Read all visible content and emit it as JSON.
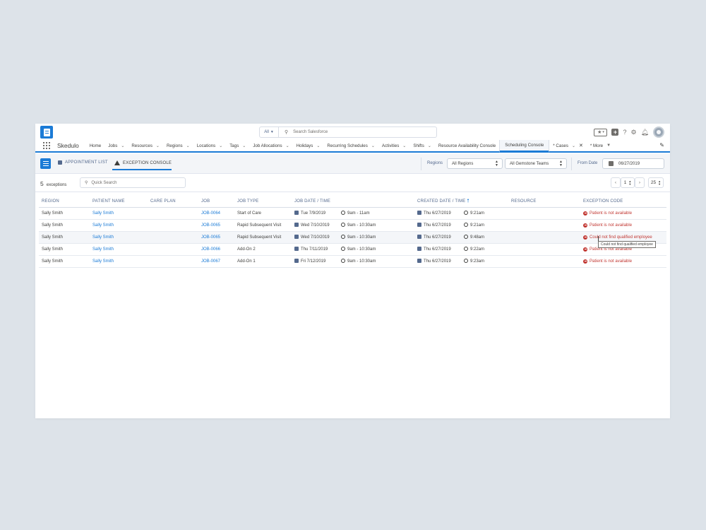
{
  "header": {
    "search_scope": "All",
    "search_placeholder": "Search Salesforce"
  },
  "nav": {
    "app_name": "Skedulo",
    "items": [
      {
        "label": "Home",
        "chevron": false
      },
      {
        "label": "Jobs",
        "chevron": true
      },
      {
        "label": "Resources",
        "chevron": true
      },
      {
        "label": "Regions",
        "chevron": true
      },
      {
        "label": "Locations",
        "chevron": true
      },
      {
        "label": "Tags",
        "chevron": true
      },
      {
        "label": "Job Allocations",
        "chevron": true
      },
      {
        "label": "Holidays",
        "chevron": true
      },
      {
        "label": "Recurring Schedules",
        "chevron": true
      },
      {
        "label": "Activities",
        "chevron": true
      },
      {
        "label": "Shifts",
        "chevron": true
      },
      {
        "label": "Resource Availability Console",
        "chevron": false
      },
      {
        "label": "Scheduling Console",
        "chevron": false,
        "active": true
      },
      {
        "label": "* Cases",
        "chevron": true,
        "close": true
      },
      {
        "label": "* More",
        "chevron": true
      }
    ]
  },
  "subheader": {
    "tab_appointment_list": "APPOINTMENT LIST",
    "tab_exception_console": "EXCEPTION CONSOLE",
    "regions_label": "Regions",
    "regions_value": "All Regions",
    "teams_value": "All Gemstone Teams",
    "from_date_label": "From Date",
    "from_date_value": "06/27/2019"
  },
  "toolbar": {
    "count": "5",
    "count_label": "exceptions",
    "quick_search_placeholder": "Quick Search",
    "page": "1",
    "page_size": "25"
  },
  "table": {
    "columns": [
      "REGION",
      "PATIENT NAME",
      "CARE PLAN",
      "JOB",
      "JOB TYPE",
      "JOB DATE / TIME",
      "",
      "CREATED DATE / TIME",
      "",
      "RESOURCE",
      "EXCEPTION CODE"
    ],
    "rows": [
      {
        "region": "Sally Smith",
        "patient": "Sally Smith",
        "care_plan": "",
        "job": "JOB-0064",
        "job_type": "Start of Care",
        "job_date": "Tue 7/9/2019",
        "job_time": "9am - 11am",
        "created_date": "Thu 6/27/2019",
        "created_time": "9:21am",
        "resource": "",
        "exception": "Patient is not available"
      },
      {
        "region": "Sally Smith",
        "patient": "Sally Smith",
        "care_plan": "",
        "job": "JOB-0065",
        "job_type": "Rapid Subsequent Visit",
        "job_date": "Wed 7/10/2019",
        "job_time": "9am - 10:30am",
        "created_date": "Thu 6/27/2019",
        "created_time": "9:21am",
        "resource": "",
        "exception": "Patient is not available"
      },
      {
        "region": "Sally Smith",
        "patient": "Sally Smith",
        "care_plan": "",
        "job": "JOB-0065",
        "job_type": "Rapid Subsequent Visit",
        "job_date": "Wed 7/10/2019",
        "job_time": "9am - 10:30am",
        "created_date": "Thu 6/27/2019",
        "created_time": "9:48am",
        "resource": "",
        "exception": "Could not find qualified employee"
      },
      {
        "region": "Sally Smith",
        "patient": "Sally Smith",
        "care_plan": "",
        "job": "JOB-0066",
        "job_type": "Add-On 2",
        "job_date": "Thu 7/11/2019",
        "job_time": "9am - 10:30am",
        "created_date": "Thu 6/27/2019",
        "created_time": "9:22am",
        "resource": "",
        "exception": "Patient is not available"
      },
      {
        "region": "Sally Smith",
        "patient": "Sally Smith",
        "care_plan": "",
        "job": "JOB-0067",
        "job_type": "Add-On 1",
        "job_date": "Fri 7/12/2019",
        "job_time": "9am - 10:30am",
        "created_date": "Thu 6/27/2019",
        "created_time": "9:23am",
        "resource": "",
        "exception": "Patient is not available"
      }
    ]
  },
  "tooltip": "Could not find qualified employee",
  "colors": {
    "accent": "#1b7bd6",
    "error": "#c23934"
  }
}
